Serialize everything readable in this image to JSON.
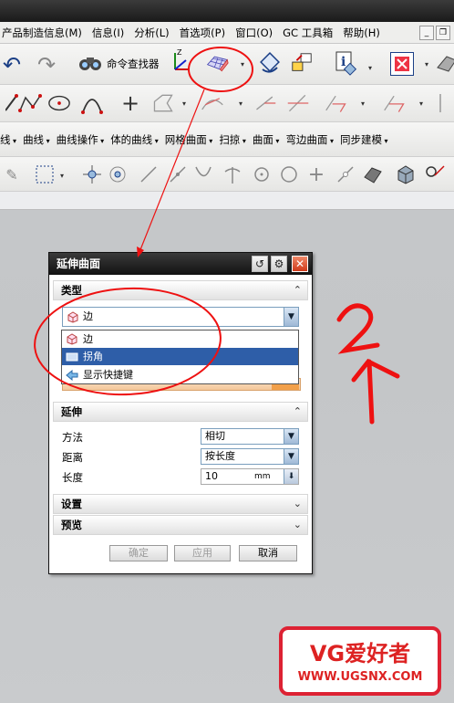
{
  "menubar": {
    "items": [
      "产品制造信息(M)",
      "信息(I)",
      "分析(L)",
      "首选项(P)",
      "窗口(O)",
      "GC 工具箱",
      "帮助(H)"
    ]
  },
  "toolbar1": {
    "command_finder_label": "命令查找器"
  },
  "toolbar3": {
    "items": [
      "线",
      "曲线",
      "曲线操作",
      "体的曲线",
      "网格曲面",
      "扫掠",
      "曲面",
      "弯边曲面",
      "同步建模"
    ]
  },
  "dialog": {
    "title": "延伸曲面",
    "sections": {
      "type": "类型",
      "extend": "延伸",
      "settings": "设置",
      "preview": "预览"
    },
    "type_value": "边",
    "dropdown_options": [
      {
        "label": "边",
        "icon": "cube-icon",
        "highlighted": false
      },
      {
        "label": "拐角",
        "icon": "surface-icon",
        "highlighted": true
      },
      {
        "label": "显示快捷键",
        "icon": "arrow-left-icon",
        "highlighted": false
      }
    ],
    "method_label": "方法",
    "method_value": "相切",
    "distance_label": "距离",
    "distance_value": "按长度",
    "length_label": "长度",
    "length_value": "10",
    "length_unit": "mm",
    "ok_label": "确定",
    "apply_label": "应用",
    "cancel_label": "取消"
  },
  "annotation": {
    "handwritten": "2个"
  },
  "watermark": {
    "main": "VG爱好者",
    "url": "WWW.UGSNX.COM"
  },
  "colors": {
    "annotation_red": "#ee1111",
    "highlight_blue": "#2e5ea8",
    "title_dark": "#1a1a1a"
  }
}
